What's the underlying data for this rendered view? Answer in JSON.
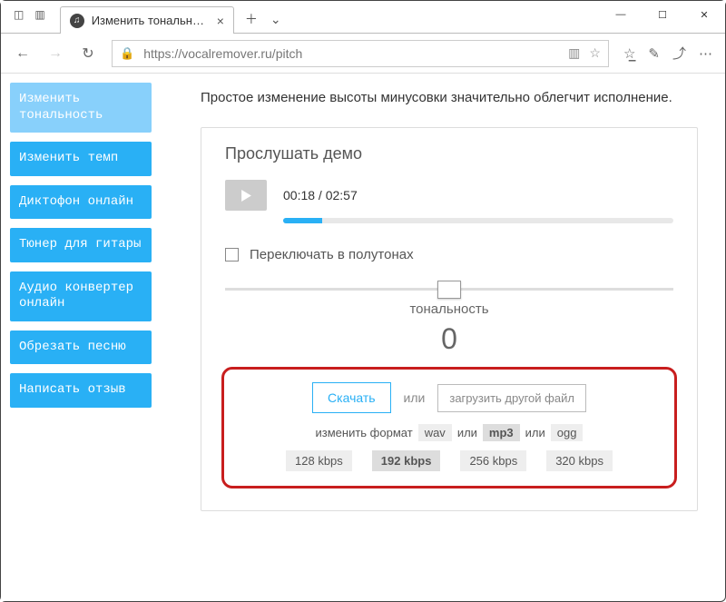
{
  "window": {
    "tab_title": "Изменить тональность",
    "url": "https://vocalremover.ru/pitch"
  },
  "sidebar": {
    "items": [
      {
        "label": "Изменить тональность",
        "active": true
      },
      {
        "label": "Изменить темп"
      },
      {
        "label": "Диктофон онлайн"
      },
      {
        "label": "Тюнер для гитары"
      },
      {
        "label": "Аудио конвертер онлайн"
      },
      {
        "label": "Обрезать песню"
      },
      {
        "label": "Написать отзыв"
      }
    ]
  },
  "main": {
    "lead": "Простое изменение высоты минусовки значительно облегчит исполнение.",
    "demo_title": "Прослушать демо",
    "time": "00:18 / 02:57",
    "semitone_label": "Переключать в полутонах",
    "tone_label": "тональность",
    "tone_value": "0"
  },
  "download": {
    "download_label": "Скачать",
    "or": "или",
    "upload_other": "загрузить другой файл",
    "change_format": "изменить формат",
    "formats": [
      "wav",
      "mp3",
      "ogg"
    ],
    "selected_format": "mp3",
    "bitrates": [
      "128 kbps",
      "192 kbps",
      "256 kbps",
      "320 kbps"
    ],
    "selected_bitrate": "192 kbps"
  }
}
